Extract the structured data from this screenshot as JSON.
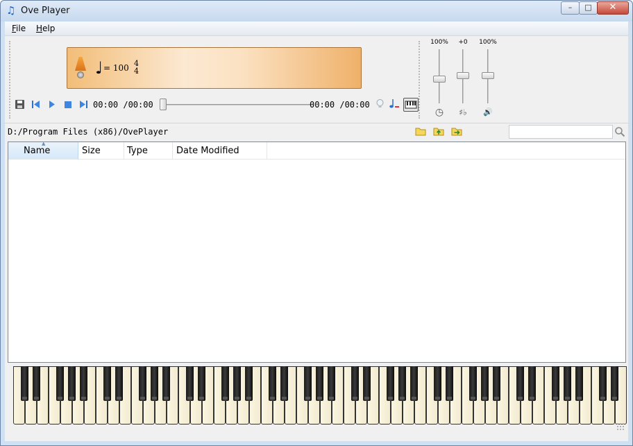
{
  "window": {
    "title": "Ove Player",
    "minimize_glyph": "–",
    "maximize_glyph": "□",
    "close_glyph": "✕"
  },
  "menu": {
    "items": [
      {
        "prefix": "",
        "underline": "F",
        "rest": "ile"
      },
      {
        "prefix": "",
        "underline": "H",
        "rest": "elp"
      }
    ]
  },
  "display": {
    "tempo": "= 100",
    "time_sig_top": "4",
    "time_sig_bottom": "4",
    "note_glyph": "♩",
    "accent_color": "#f2bd78"
  },
  "transport": {
    "elapsed": "00:00 /00:00",
    "remaining": "00:00 /00:00",
    "seek_fraction": 0
  },
  "sliders": [
    {
      "label": "100%",
      "icon": "clock-icon",
      "glyph": "◷",
      "level": 0.6
    },
    {
      "label": "+0",
      "icon": "sharp-flat-icon",
      "glyph": "♯♭",
      "level": 0.5
    },
    {
      "label": "100%",
      "icon": "speaker-icon",
      "glyph": "🔊",
      "level": 0.6
    }
  ],
  "path": {
    "current": "D:/Program Files (x86)/OvePlayer",
    "search_placeholder": ""
  },
  "file_list": {
    "columns": [
      "Name",
      "Size",
      "Type",
      "Date Modified"
    ],
    "sorted_column": "Name",
    "rows": []
  }
}
